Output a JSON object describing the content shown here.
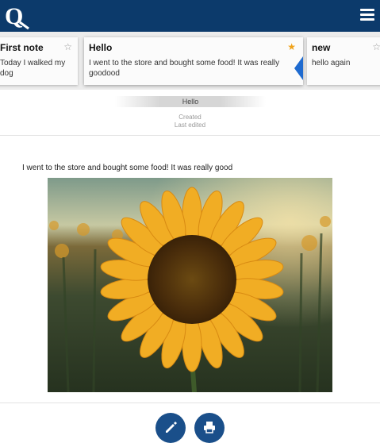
{
  "app": {
    "logo_letter": "Q",
    "header_color": "#0c3a6b",
    "icons": {
      "menu": "hamburger-menu-icon",
      "edit": "pencil-icon",
      "print": "printer-icon",
      "star": "star-icon"
    }
  },
  "notes": [
    {
      "title": "First note",
      "body": "Today I walked my dog",
      "starred": false
    },
    {
      "title": "Hello",
      "body": "I went to the store and bought some food! It was really goodood",
      "starred": true,
      "active": true
    },
    {
      "title": "new",
      "body": "hello again",
      "starred": false
    }
  ],
  "current_note": {
    "title": "Hello",
    "created_label": "Created",
    "edited_label": "Last edited",
    "text": "I went to the store and bought some food! It was really good",
    "image_alt": "sunflower"
  },
  "colors": {
    "accent": "#1f6bd0",
    "star_active": "#f0a21a",
    "fab": "#1a4f8a"
  }
}
